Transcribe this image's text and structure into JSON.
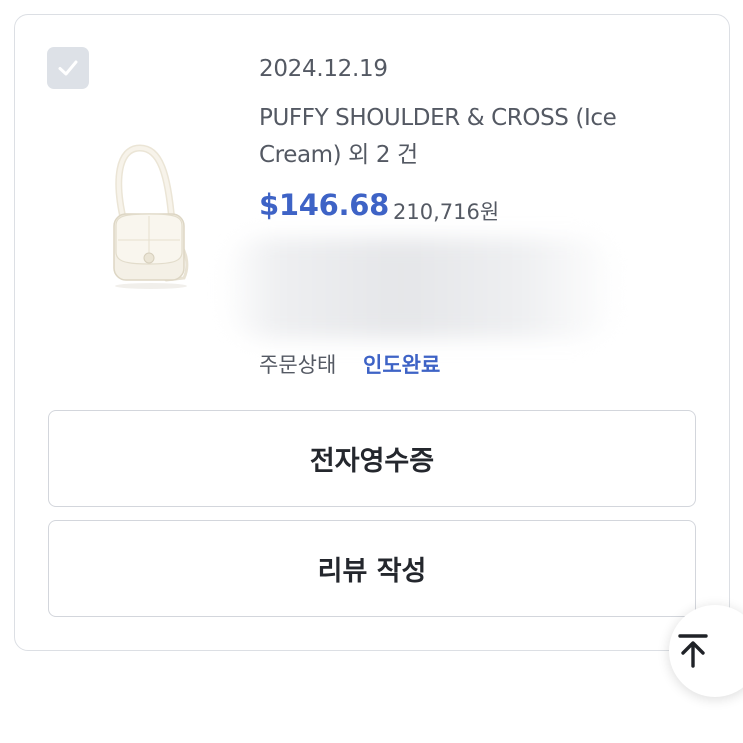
{
  "order": {
    "date": "2024.12.19",
    "title": "PUFFY SHOULDER & CROSS (Ice Cream) 외 2 건",
    "price_usd": "$146.68",
    "price_krw": "210,716원",
    "status_label": "주문상태",
    "status_value": "인도완료",
    "checkbox_checked": true,
    "product_image": "cream-shoulder-bag"
  },
  "actions": {
    "receipt_label": "전자영수증",
    "review_label": "리뷰 작성"
  },
  "icons": {
    "checkbox": "check-icon",
    "scroll_top": "arrow-up-to-top-icon"
  },
  "colors": {
    "accent": "#3e63c6",
    "text": "#545963",
    "checkbox_bg": "#dde1e7"
  }
}
